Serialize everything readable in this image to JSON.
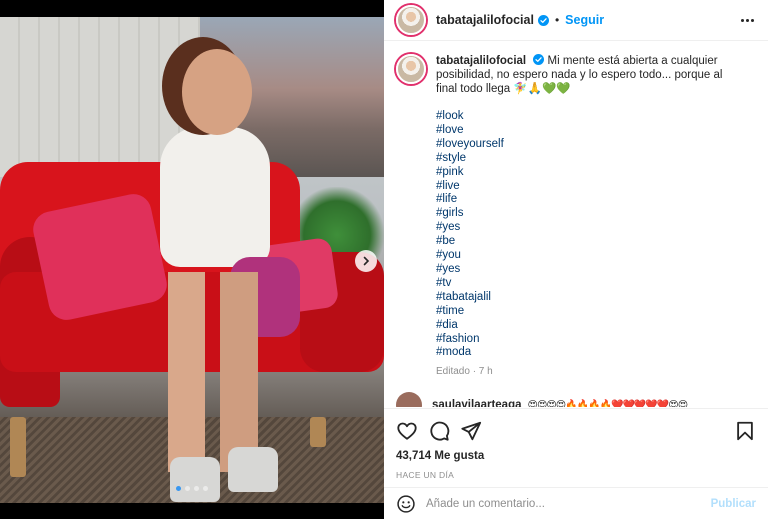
{
  "post": {
    "username": "tabatajalilofocial",
    "follow_label": "Seguir",
    "separator": "•",
    "caption_text": "Mi mente está abierta a cualquier posibilidad, no espero nada y lo espero todo... porque al final todo llega 🧚‍♀️🙏💚💚",
    "hashtags": [
      "#look",
      "#love",
      "#loveyourself",
      "#style",
      "#pink",
      "#live",
      "#life",
      "#girls",
      "#yes",
      "#be",
      "#you",
      "#yes",
      "#tv",
      "#tabatajalil",
      "#time",
      "#dia",
      "#fashion",
      "#moda"
    ],
    "edited": "Editado · 7 h",
    "next_comment_user": "saulavilaarteaga",
    "next_comment_text": "😍😍😍😍🔥🔥🔥🔥❤️❤️❤️❤️❤️😍😍",
    "likes": "43,714 Me gusta",
    "date": "HACE UN DÍA"
  },
  "comment_box": {
    "placeholder": "Añade un comentario...",
    "publish_label": "Publicar"
  },
  "carousel": {
    "total": 4,
    "active_index": 0
  },
  "icons": {
    "verified": "verified-badge-icon",
    "more": "more-options-icon",
    "like": "heart-icon",
    "comment": "comment-icon",
    "share": "share-icon",
    "save": "bookmark-icon",
    "emoji": "emoji-icon",
    "next": "chevron-right-icon"
  },
  "colors": {
    "accent": "#0095f6",
    "hashtag": "#00376b",
    "muted": "#8e8e8e",
    "publish_disabled": "#b2dffc"
  }
}
